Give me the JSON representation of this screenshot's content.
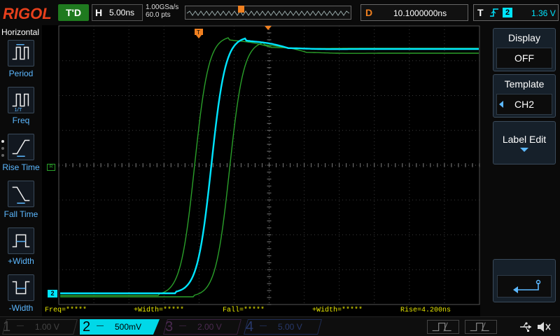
{
  "header": {
    "logo": "RIGOL",
    "run_status": "T'D",
    "timebase_label": "H",
    "timebase_value": "5.00ns",
    "sample_rate": "1.00GSa/s",
    "memory_depth": "60.0 pts",
    "delay_label": "D",
    "delay_value": "10.1000000ns",
    "trigger_label": "T",
    "trigger_source": "2",
    "trigger_level": "1.36 V"
  },
  "left_menu": {
    "title": "Horizontal",
    "items": [
      {
        "label": "Period",
        "icon": "period-icon"
      },
      {
        "label": "Freq",
        "icon": "freq-icon"
      },
      {
        "label": "Rise Time",
        "icon": "rise-time-icon"
      },
      {
        "label": "Fall Time",
        "icon": "fall-time-icon"
      },
      {
        "label": "+Width",
        "icon": "positive-width-icon"
      },
      {
        "label": "-Width",
        "icon": "negative-width-icon"
      }
    ]
  },
  "right_menu": {
    "display_title": "Display",
    "display_value": "OFF",
    "template_title": "Template",
    "template_value": "CH2",
    "label_edit": "Label Edit",
    "return_icon": "return-icon"
  },
  "measurements": [
    "Freq=*****",
    "+Width=*****",
    "Fall=*****",
    "+Width=*****",
    "Rise=4.200ns"
  ],
  "markers": {
    "channel_marker": "2",
    "trigger_level_marker": "T",
    "trigger_pos_marker": "T",
    "mask_marker": "R"
  },
  "channels": [
    {
      "num": "1",
      "coupling": "—",
      "scale": "1.00 V"
    },
    {
      "num": "2",
      "coupling": "—",
      "scale": "500mV"
    },
    {
      "num": "3",
      "coupling": "—",
      "scale": "2.00 V"
    },
    {
      "num": "4",
      "coupling": "—",
      "scale": "5.00 V"
    }
  ],
  "colors": {
    "ch2_trace": "#00e5ff",
    "mask": "#2aa02a",
    "measure_text": "#e8e800",
    "trigger": "#f08020",
    "accent_blue": "#5cb8ff",
    "logo": "#e8401c"
  }
}
